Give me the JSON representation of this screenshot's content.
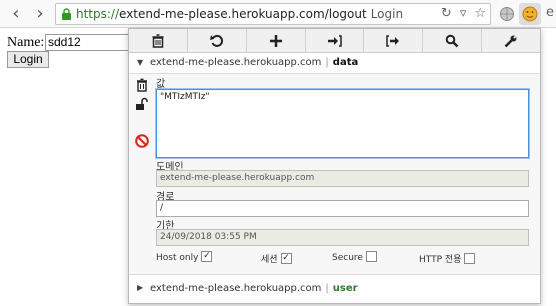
{
  "browser": {
    "url_scheme_path": "https://",
    "url_host": "extend-me-please.herokuapp.com",
    "url_path": "/logout",
    "page_title": "Login",
    "back_icon": "back-icon",
    "forward_icon": "forward-icon",
    "extension_icon": "cookie-icon"
  },
  "page": {
    "name_label": "Name:",
    "name_value": "sdd12",
    "login_label": "Login"
  },
  "popup": {
    "toolbar": [
      "trash-icon",
      "undo-icon",
      "add-icon",
      "import-icon",
      "export-icon",
      "search-icon",
      "wrench-icon"
    ],
    "cookie1": {
      "domain": "extend-me-please.herokuapp.com",
      "separator": "|",
      "name": "data"
    },
    "cookie2": {
      "domain": "extend-me-please.herokuapp.com",
      "separator": "|",
      "name": "user"
    },
    "editor": {
      "value_label": "값",
      "value": "\"MTIzMTIz\"",
      "domain_label": "도메인",
      "domain": "extend-me-please.herokuapp.com",
      "path_label": "경로",
      "path": "/",
      "expiry_label": "기한",
      "expiry": "24/09/2018 03:55 PM",
      "hostonly_label": "Host only",
      "session_label": "세션",
      "secure_label": "Secure",
      "httponly_label": "HTTP 전용"
    },
    "flags": {
      "hostonly": true,
      "session": true,
      "secure": false,
      "httponly": false
    }
  },
  "colors": {
    "accent": "#4a90d9",
    "url_green": "#2a7a2a",
    "cookie_user": "#2c7a2c",
    "block_red": "#d9241c"
  }
}
